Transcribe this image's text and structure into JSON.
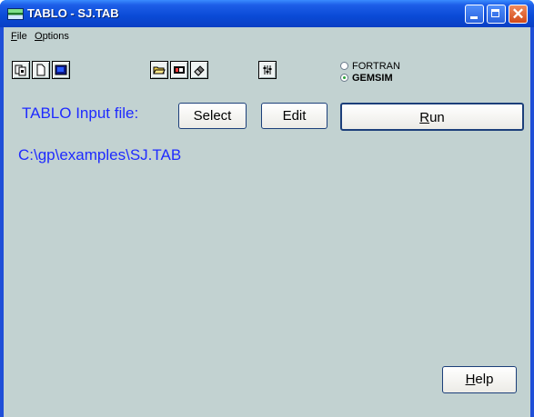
{
  "window": {
    "title": "TABLO - SJ.TAB",
    "controls": {
      "minimize": "minimize",
      "maximize": "maximize",
      "close": "✕"
    }
  },
  "menu": {
    "file": {
      "accel": "F",
      "rest": "ile"
    },
    "options": {
      "accel": "O",
      "rest": "ptions"
    }
  },
  "toolbar": {
    "icons": [
      "copy-files-icon",
      "new-file-icon",
      "screen-icon",
      "open-folder-icon",
      "card-icon",
      "eraser-icon",
      "settings-sliders-icon"
    ]
  },
  "compiler": {
    "options": [
      "FORTRAN",
      "GEMSIM"
    ],
    "selected": "GEMSIM"
  },
  "main": {
    "input_label": "TABLO Input file:",
    "select_label": "Select",
    "edit_label": "Edit",
    "run_accel": "R",
    "run_rest": "un",
    "file_path": "C:\\gp\\examples\\SJ.TAB",
    "help_accel": "H",
    "help_rest": "elp"
  }
}
